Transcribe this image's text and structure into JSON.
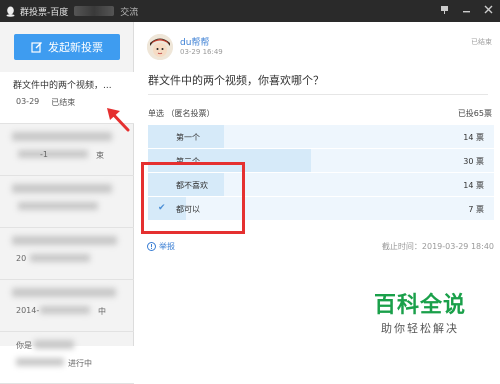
{
  "window": {
    "title": "群投票-百度",
    "title_suffix": "交流",
    "icons": [
      "pin-icon",
      "minimize-icon",
      "close-icon"
    ]
  },
  "sidebar": {
    "new_vote_label": "发起新投票",
    "items": [
      {
        "title": "群文件中的两个视频，...",
        "date": "03-29",
        "status": "已结束",
        "active": true
      },
      {
        "text_a": "-1",
        "text_b": "束"
      },
      {
        "text_a": "",
        "text_b": ""
      },
      {
        "text_a": "20",
        "text_b": ""
      },
      {
        "text_a": "2014-",
        "text_b": "中"
      },
      {
        "text_a": "你是",
        "text_b": "进行中"
      }
    ]
  },
  "detail": {
    "author": "du帮帮",
    "time": "03-29 16:49",
    "status": "已结束",
    "question": "群文件中的两个视频，你喜欢哪个？",
    "vote_type": "单选 （匿名投票）",
    "total": "已投65票",
    "options": [
      {
        "label": "第一个",
        "count": "14 票",
        "share": 0.215,
        "checked": false
      },
      {
        "label": "第二个",
        "count": "30 票",
        "share": 0.462,
        "checked": false
      },
      {
        "label": "都不喜欢",
        "count": "14 票",
        "share": 0.215,
        "checked": false
      },
      {
        "label": "都可以",
        "count": "7 票",
        "share": 0.108,
        "checked": true
      }
    ],
    "report_label": "举报",
    "deadline": "截止时间：2019-03-29 18:40"
  },
  "watermark": {
    "main": "百科全说",
    "sub": "助你轻松解决"
  },
  "colors": {
    "accent": "#3e9cf0",
    "link": "#3b7fd4",
    "highlight": "#e53030",
    "watermark_green": "#1aa04a"
  }
}
